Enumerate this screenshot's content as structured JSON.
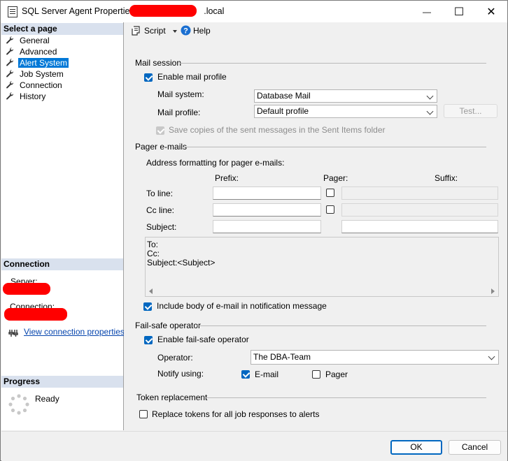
{
  "window": {
    "title_prefix": "SQL Server Agent Properties",
    "title_suffix": ".local",
    "minimize": "—",
    "maximize": "☐",
    "close": "✕"
  },
  "left": {
    "select_page": "Select a page",
    "pages": [
      {
        "label": "General"
      },
      {
        "label": "Advanced"
      },
      {
        "label": "Alert System"
      },
      {
        "label": "Job System"
      },
      {
        "label": "Connection"
      },
      {
        "label": "History"
      }
    ],
    "connection_header": "Connection",
    "server_label": "Server:",
    "connection_label": "Connection:",
    "view_props": "View connection properties",
    "progress_header": "Progress",
    "progress_status": "Ready"
  },
  "toolbar": {
    "script": "Script",
    "help": "Help"
  },
  "mail": {
    "title": "Mail session",
    "enable": "Enable mail profile",
    "system_label": "Mail system:",
    "system_value": "Database Mail",
    "profile_label": "Mail profile:",
    "profile_value": "Default profile",
    "test": "Test...",
    "save_copies": "Save copies of the sent messages in the Sent Items folder"
  },
  "pager": {
    "title": "Pager e-mails",
    "address_format": "Address formatting for pager e-mails:",
    "prefix": "Prefix:",
    "pager": "Pager:",
    "suffix": "Suffix:",
    "to_line": "To line:",
    "cc_line": "Cc line:",
    "subject": "Subject:",
    "preview_to": "To:",
    "preview_cc": "Cc:",
    "preview_subject": "Subject:<Subject>",
    "include_body": "Include body of e-mail in notification message"
  },
  "failsafe": {
    "title": "Fail-safe operator",
    "enable": "Enable fail-safe operator",
    "operator_label": "Operator:",
    "operator_value": "The DBA-Team",
    "notify_label": "Notify using:",
    "email": "E-mail",
    "pager": "Pager"
  },
  "token": {
    "title": "Token replacement",
    "replace": "Replace tokens for all job responses to alerts"
  },
  "footer": {
    "ok": "OK",
    "cancel": "Cancel"
  }
}
